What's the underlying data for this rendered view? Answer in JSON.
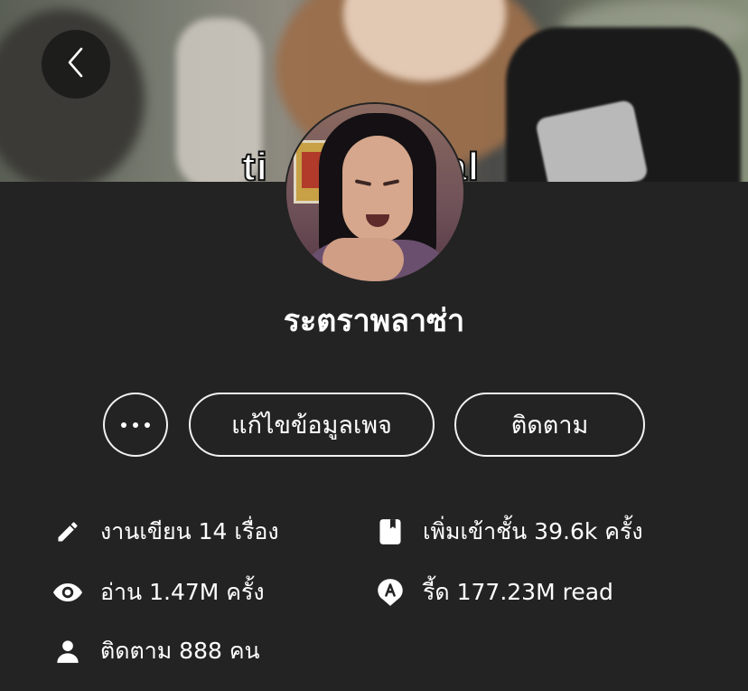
{
  "cover": {
    "caption_left": "ti",
    "caption_right": "eal"
  },
  "profile": {
    "name": "ระตราพลาซ่า"
  },
  "actions": {
    "more_label": "more",
    "edit_label": "แก้ไขข้อมูลเพจ",
    "follow_label": "ติดตาม"
  },
  "stats": {
    "works": "งานเขียน 14 เรื่อง",
    "reads": "อ่าน 1.47M ครั้ง",
    "followers": "ติดตาม 888 คน",
    "library_adds": "เพิ่มเข้าชั้น 39.6k ครั้ง",
    "reader_reads": "รี้ด 177.23M read"
  },
  "icons": {
    "back": "chevron-left-icon",
    "more": "ellipsis-icon",
    "works": "pencil-icon",
    "reads": "eye-icon",
    "followers": "person-icon",
    "library_adds": "bookmark-book-icon",
    "reader_reads": "speech-bubble-a-icon"
  },
  "colors": {
    "background": "#232323",
    "text": "#ffffff",
    "button_border": "#f2f2f2"
  }
}
